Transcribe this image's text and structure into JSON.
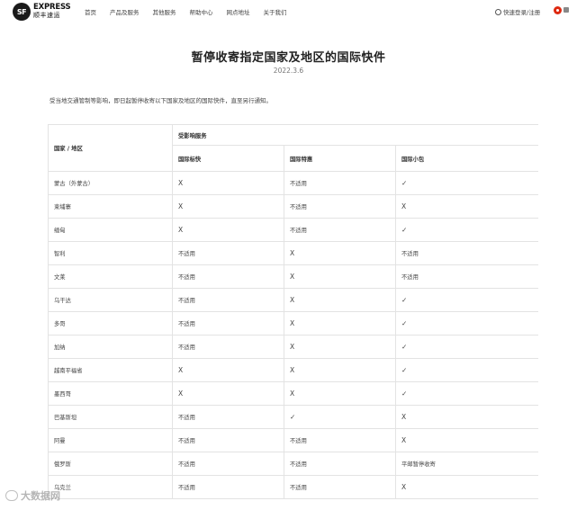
{
  "header": {
    "logo_en": "EXPRESS",
    "logo_mark": "SF",
    "logo_cn": "顺丰速运",
    "nav": [
      "首页",
      "产品及服务",
      "其他服务",
      "帮助中心",
      "网点地址",
      "关于我们"
    ],
    "login_label": "快速登录/注册"
  },
  "title": "暂停收寄指定国家及地区的国际快件",
  "date": "2022.3.6",
  "notice": "受当地交通管制等影响，即日起暂停收寄以下国家及地区的国际快件，直至另行通知。",
  "table": {
    "country_header": "国家 / 地区",
    "group_header": "受影响服务",
    "service_headers": [
      "国际标快",
      "国际特惠",
      "国际小包"
    ],
    "rows": [
      {
        "country": "蒙古（外蒙古）",
        "values": [
          "X",
          "不适用",
          "✓"
        ]
      },
      {
        "country": "柬埔寨",
        "values": [
          "X",
          "不适用",
          "X"
        ]
      },
      {
        "country": "缅甸",
        "values": [
          "X",
          "不适用",
          "✓"
        ]
      },
      {
        "country": "智利",
        "values": [
          "不适用",
          "X",
          "不适用"
        ]
      },
      {
        "country": "文莱",
        "values": [
          "不适用",
          "X",
          "不适用"
        ]
      },
      {
        "country": "乌干达",
        "values": [
          "不适用",
          "X",
          "✓"
        ]
      },
      {
        "country": "多哥",
        "values": [
          "不适用",
          "X",
          "✓"
        ]
      },
      {
        "country": "加纳",
        "values": [
          "不适用",
          "X",
          "✓"
        ]
      },
      {
        "country": "越南平福省",
        "values": [
          "X",
          "X",
          "✓"
        ]
      },
      {
        "country": "墨西哥",
        "values": [
          "X",
          "X",
          "✓"
        ]
      },
      {
        "country": "巴基斯坦",
        "values": [
          "不适用",
          "✓",
          "X"
        ]
      },
      {
        "country": "阿曼",
        "values": [
          "不适用",
          "不适用",
          "X"
        ]
      },
      {
        "country": "俄罗斯",
        "values": [
          "不适用",
          "不适用",
          "平邮暂停收寄"
        ]
      },
      {
        "country": "乌克兰",
        "values": [
          "不适用",
          "不适用",
          "X"
        ]
      }
    ]
  },
  "watermark": "大数据网"
}
